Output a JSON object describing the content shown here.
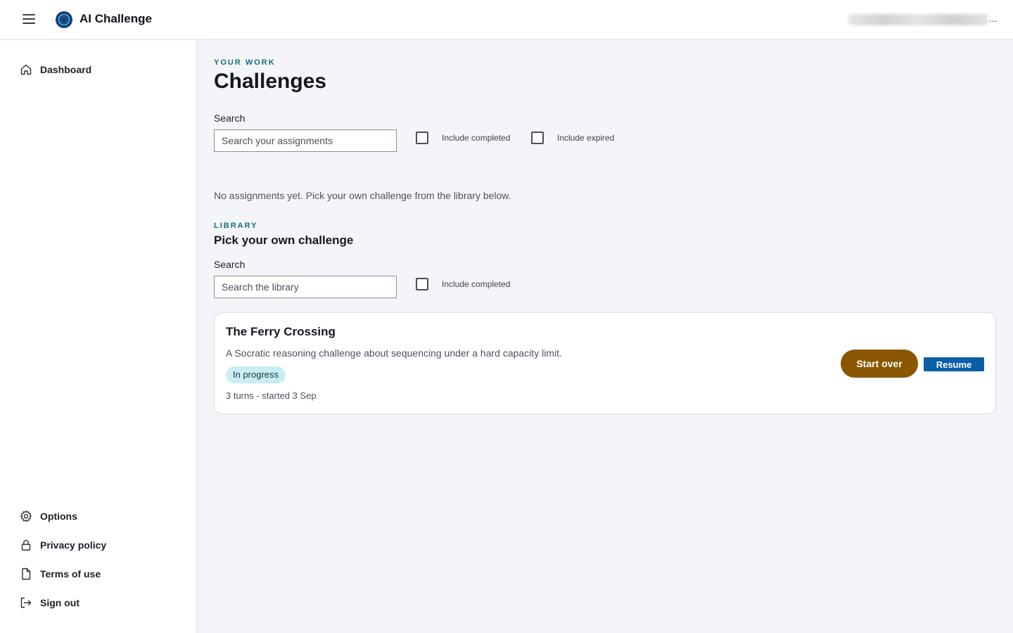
{
  "header": {
    "app_title": "AI Challenge",
    "user_ellipsis": "...",
    "icons": {
      "menu": "hamburger-menu-icon",
      "logo": "ai-challenge-logo"
    }
  },
  "sidebar": {
    "top_items": [
      {
        "label": "Dashboard",
        "icon": "home-icon"
      }
    ],
    "bottom_items": [
      {
        "label": "Options",
        "icon": "gear-icon"
      },
      {
        "label": "Privacy policy",
        "icon": "lock-icon"
      },
      {
        "label": "Terms of use",
        "icon": "document-icon"
      },
      {
        "label": "Sign out",
        "icon": "sign-out-icon"
      }
    ]
  },
  "work": {
    "eyebrow": "YOUR WORK",
    "title": "Challenges",
    "search_label": "Search",
    "search_placeholder": "Search your assignments",
    "include_completed": "Include completed",
    "include_expired": "Include expired",
    "empty_message": "No assignments yet. Pick your own challenge from the library below."
  },
  "library": {
    "eyebrow": "LIBRARY",
    "title": "Pick your own challenge",
    "search_label": "Search",
    "search_placeholder": "Search the library",
    "include_completed": "Include completed",
    "items": [
      {
        "title": "The Ferry Crossing",
        "description": "A Socratic reasoning challenge about sequencing under a hard capacity limit.",
        "status": "In progress",
        "meta": "3 turns - started 3 Sep",
        "start_over_label": "Start over",
        "resume_label": "Resume"
      }
    ]
  },
  "colors": {
    "accent_teal": "#1d6b7a",
    "badge_bg": "#c9eef2",
    "start_over_bg": "#8a5600",
    "resume_bg": "#0d5ea8",
    "main_bg": "#f4f5f8"
  }
}
